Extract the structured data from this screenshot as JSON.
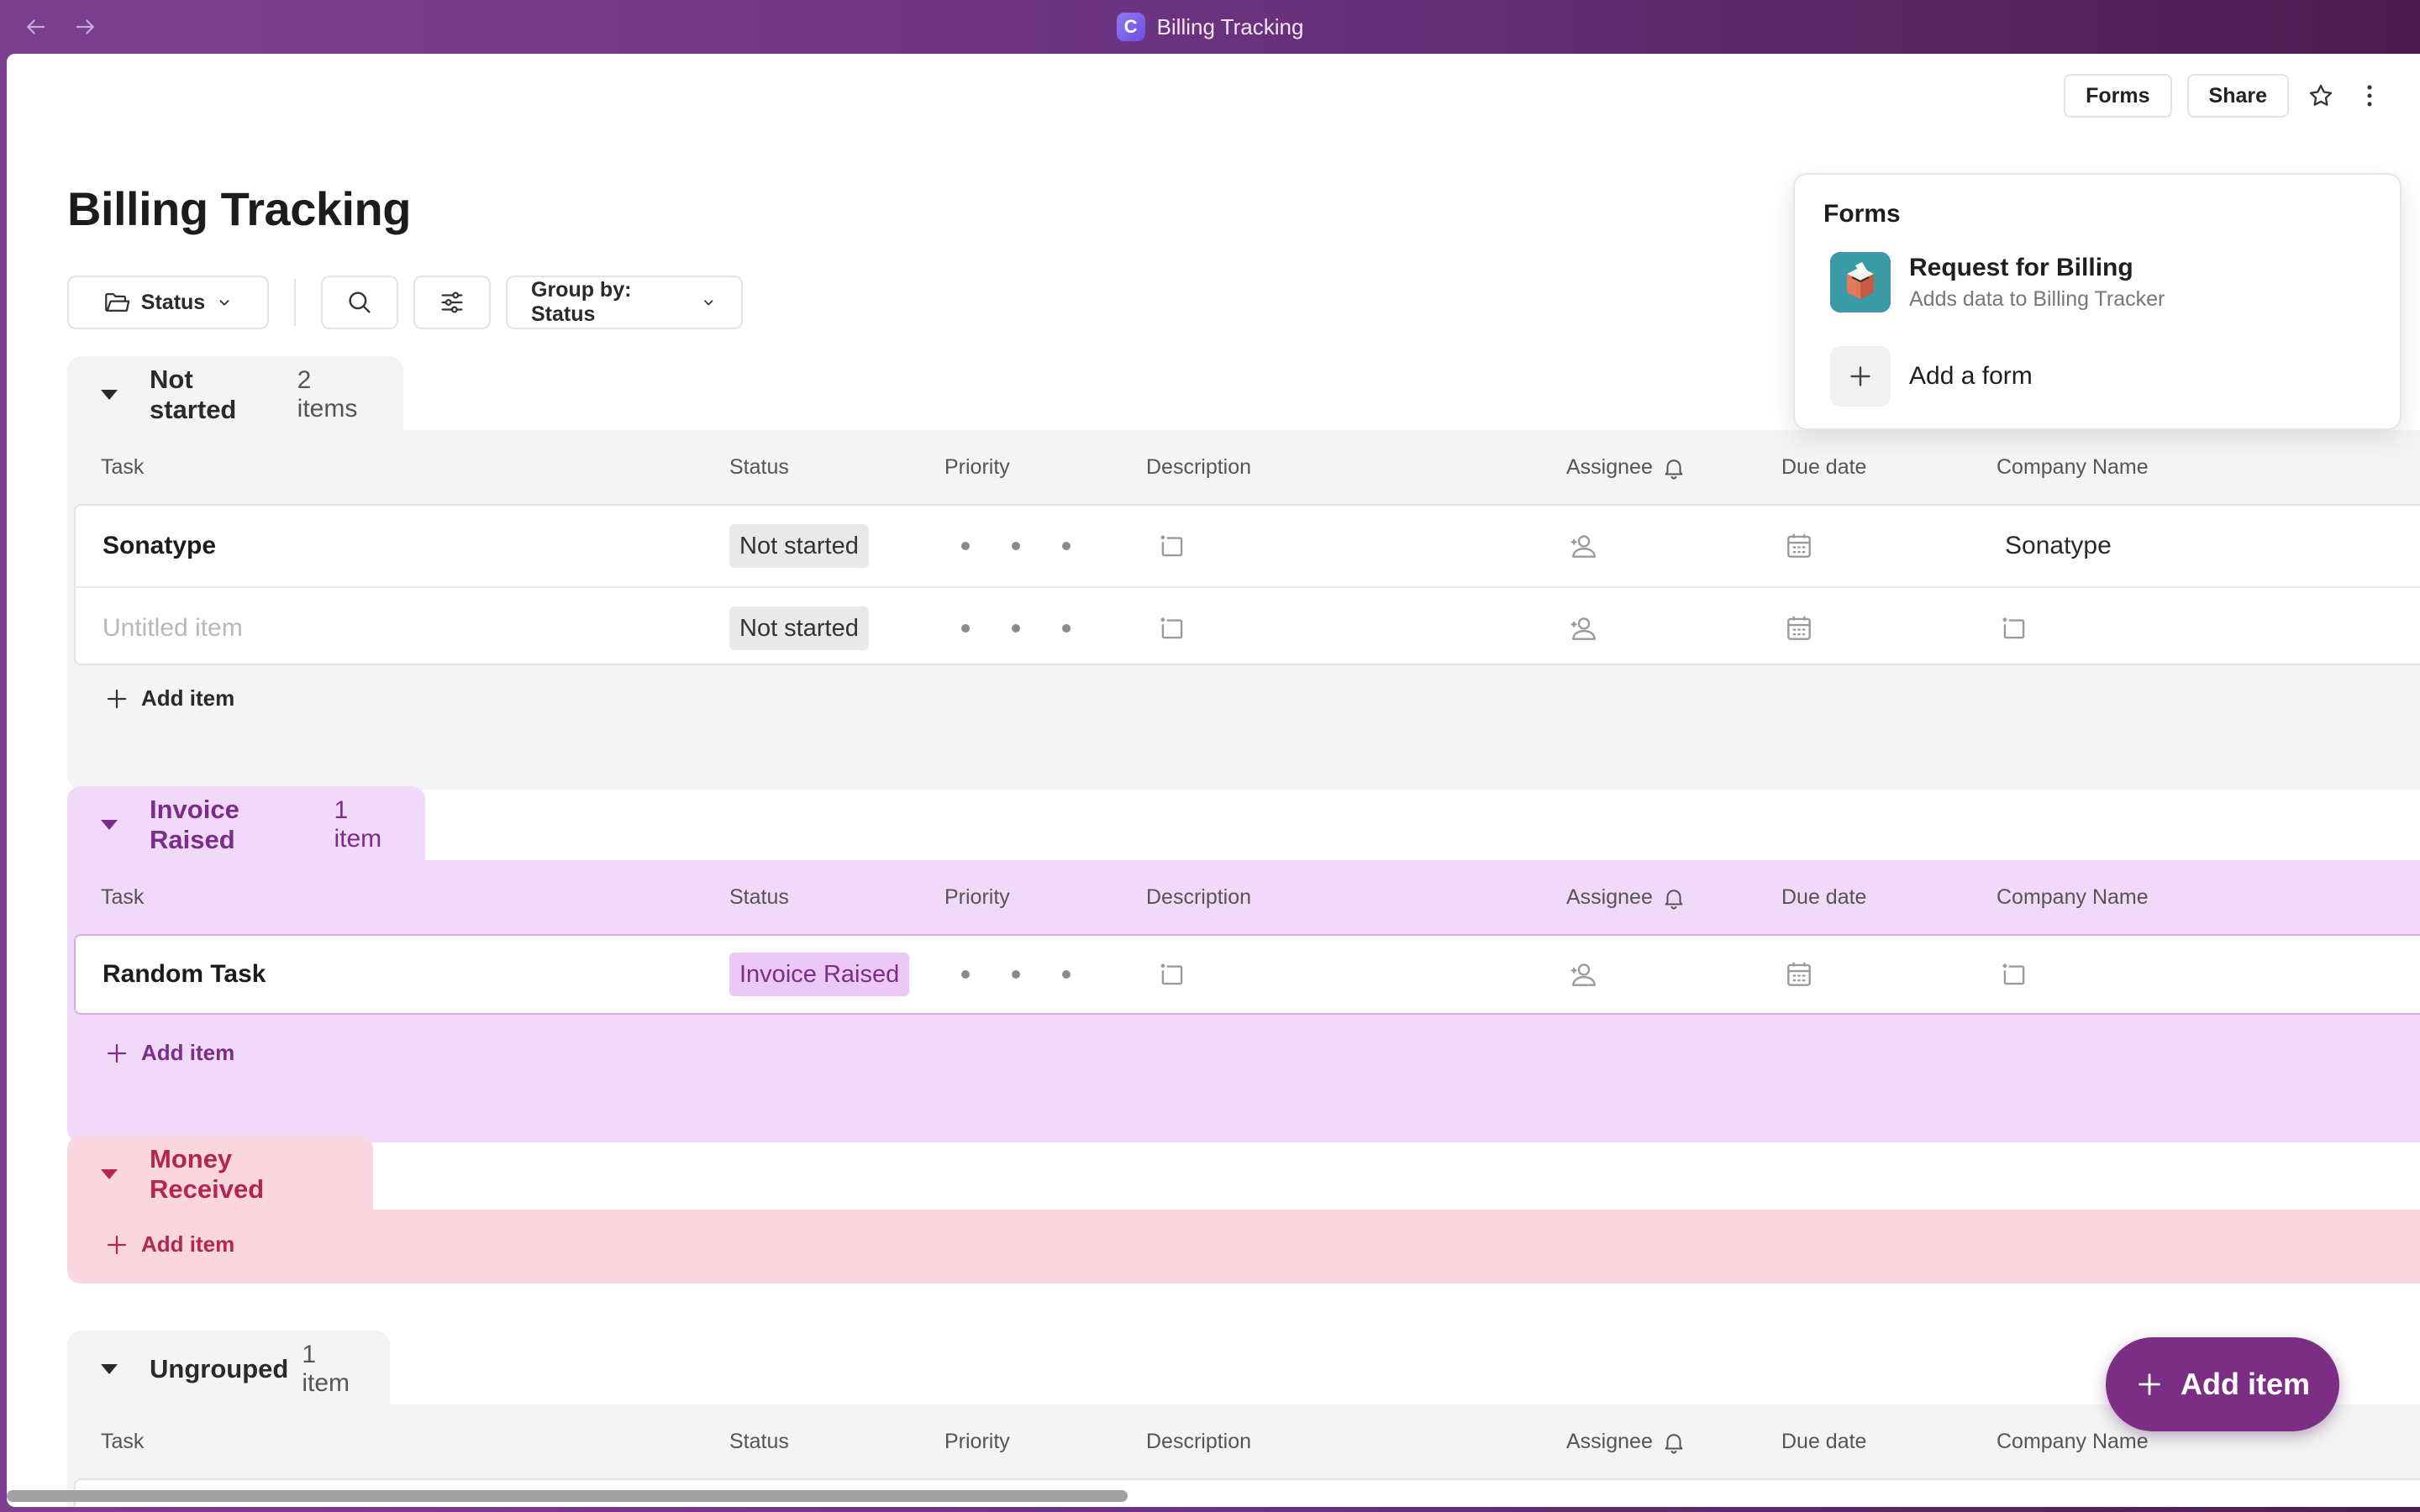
{
  "window": {
    "title": "Billing Tracking",
    "logo_letter": "C"
  },
  "header": {
    "forms_label": "Forms",
    "share_label": "Share"
  },
  "page": {
    "title": "Billing Tracking"
  },
  "toolbar": {
    "status_label": "Status",
    "group_by_label": "Group by: Status"
  },
  "columns": [
    "Task",
    "Status",
    "Priority",
    "Description",
    "Assignee",
    "Due date",
    "Company Name"
  ],
  "groups": {
    "not_started": {
      "name": "Not started",
      "count": "2 items",
      "rows": [
        {
          "task": "Sonatype",
          "status": "Not started",
          "company": "Sonatype"
        },
        {
          "task": "Untitled item",
          "status": "Not started",
          "company": ""
        }
      ]
    },
    "invoice_raised": {
      "name": "Invoice Raised",
      "count": "1 item",
      "rows": [
        {
          "task": "Random Task",
          "status": "Invoice Raised",
          "company": ""
        }
      ]
    },
    "money_received": {
      "name": "Money Received",
      "count": ""
    },
    "ungrouped": {
      "name": "Ungrouped",
      "count": "1 item"
    }
  },
  "add_item_label": "Add item",
  "popover": {
    "title": "Forms",
    "form_name": "Request for Billing",
    "form_description": "Adds data to Billing Tracker",
    "add_form_label": "Add a form"
  },
  "fab": {
    "label": "Add item"
  },
  "colors": {
    "gray_group": "#f4f4f4",
    "purple_group": "#f0d9f9",
    "purple_text": "#7a2e88",
    "pink_group": "#f9d6e0",
    "pink_text": "#b3264e",
    "fab": "#7b2e83"
  }
}
